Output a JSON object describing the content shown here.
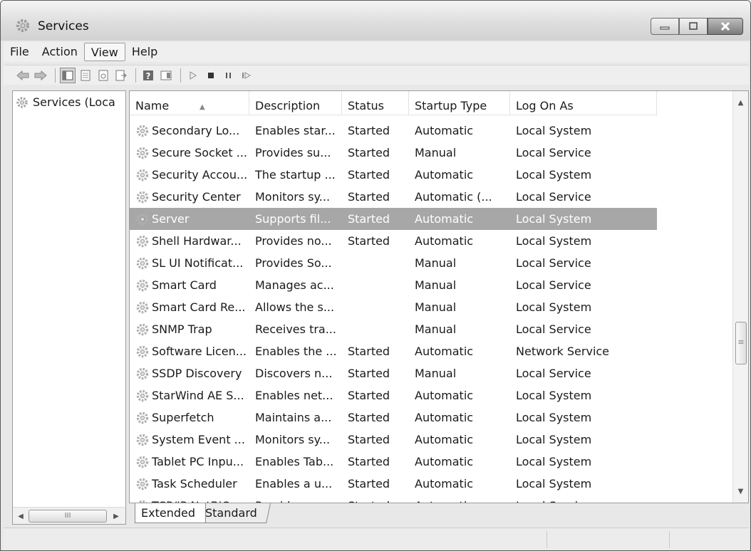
{
  "window": {
    "title": "Services",
    "icon": "gear-icon",
    "controls": [
      "minimize-icon",
      "maximize-icon",
      "close-icon"
    ]
  },
  "menu": [
    {
      "label": "File"
    },
    {
      "label": "Action"
    },
    {
      "label": "View",
      "active": true
    },
    {
      "label": "Help"
    }
  ],
  "toolbar": {
    "buttons": [
      "back-icon",
      "forward-icon",
      "show-hide-console-tree-icon",
      "properties-icon",
      "refresh-icon",
      "export-list-icon",
      "help-icon",
      "action-pane-icon",
      "start-service-icon",
      "stop-service-icon",
      "pause-service-icon",
      "resume-service-icon"
    ]
  },
  "tree": {
    "root_label": "Services (Loca"
  },
  "table": {
    "columns": [
      "Name",
      "Description",
      "Status",
      "Startup Type",
      "Log On As"
    ],
    "sorted_column": "Name",
    "rows": [
      {
        "name": "Secondary Lo...",
        "description": "Enables star...",
        "status": "Started",
        "startup": "Automatic",
        "logon": "Local System"
      },
      {
        "name": "Secure Socket ...",
        "description": "Provides su...",
        "status": "Started",
        "startup": "Manual",
        "logon": "Local Service"
      },
      {
        "name": "Security Accou...",
        "description": "The startup ...",
        "status": "Started",
        "startup": "Automatic",
        "logon": "Local System"
      },
      {
        "name": "Security Center",
        "description": "Monitors sy...",
        "status": "Started",
        "startup": "Automatic (...",
        "logon": "Local Service"
      },
      {
        "name": "Server",
        "description": "Supports fil...",
        "status": "Started",
        "startup": "Automatic",
        "logon": "Local System",
        "selected": true
      },
      {
        "name": "Shell Hardwar...",
        "description": "Provides no...",
        "status": "Started",
        "startup": "Automatic",
        "logon": "Local System"
      },
      {
        "name": "SL UI Notificat...",
        "description": "Provides So...",
        "status": "",
        "startup": "Manual",
        "logon": "Local Service"
      },
      {
        "name": "Smart Card",
        "description": "Manages ac...",
        "status": "",
        "startup": "Manual",
        "logon": "Local Service"
      },
      {
        "name": "Smart Card Re...",
        "description": "Allows the s...",
        "status": "",
        "startup": "Manual",
        "logon": "Local System"
      },
      {
        "name": "SNMP Trap",
        "description": "Receives tra...",
        "status": "",
        "startup": "Manual",
        "logon": "Local Service"
      },
      {
        "name": "Software Licen...",
        "description": "Enables the ...",
        "status": "Started",
        "startup": "Automatic",
        "logon": "Network Service"
      },
      {
        "name": "SSDP Discovery",
        "description": "Discovers n...",
        "status": "Started",
        "startup": "Manual",
        "logon": "Local Service"
      },
      {
        "name": "StarWind AE S...",
        "description": "Enables net...",
        "status": "Started",
        "startup": "Automatic",
        "logon": "Local System"
      },
      {
        "name": "Superfetch",
        "description": "Maintains a...",
        "status": "Started",
        "startup": "Automatic",
        "logon": "Local System"
      },
      {
        "name": "System Event ...",
        "description": "Monitors sy...",
        "status": "Started",
        "startup": "Automatic",
        "logon": "Local System"
      },
      {
        "name": "Tablet PC Inpu...",
        "description": "Enables Tab...",
        "status": "Started",
        "startup": "Automatic",
        "logon": "Local System"
      },
      {
        "name": "Task Scheduler",
        "description": "Enables a u...",
        "status": "Started",
        "startup": "Automatic",
        "logon": "Local System"
      },
      {
        "name": "TCP/IP NetBIO...",
        "description": "Provides su...",
        "status": "Started",
        "startup": "Automatic",
        "logon": "Local Service"
      }
    ]
  },
  "tabs": [
    {
      "label": "Extended"
    },
    {
      "label": "Standard",
      "active": true
    }
  ],
  "colors": {
    "selection": "#a7a7a7",
    "titlebar": "#dcdcdc",
    "chrome": "#efefef"
  }
}
